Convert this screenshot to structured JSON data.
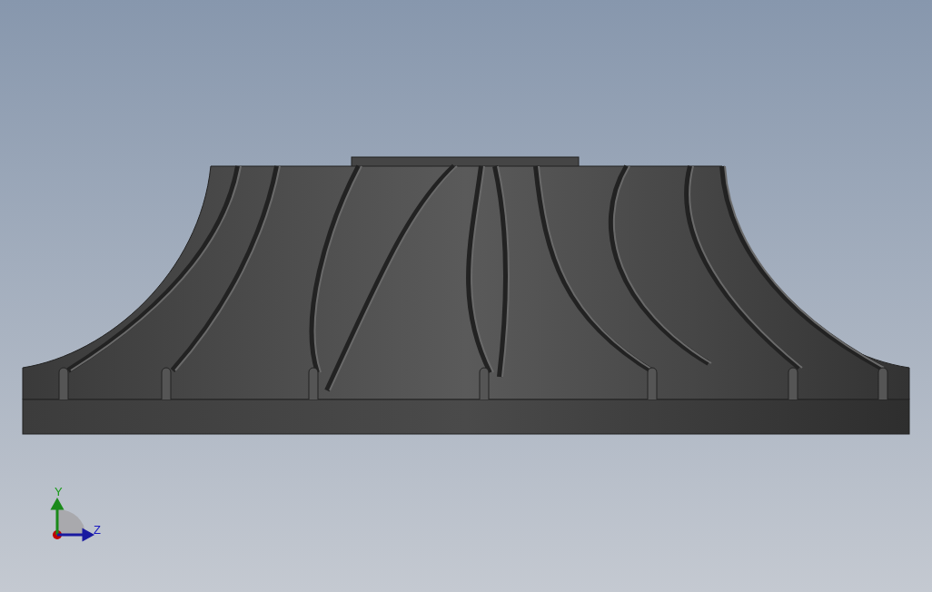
{
  "triad": {
    "y_label": "Y",
    "z_label": "Z"
  }
}
